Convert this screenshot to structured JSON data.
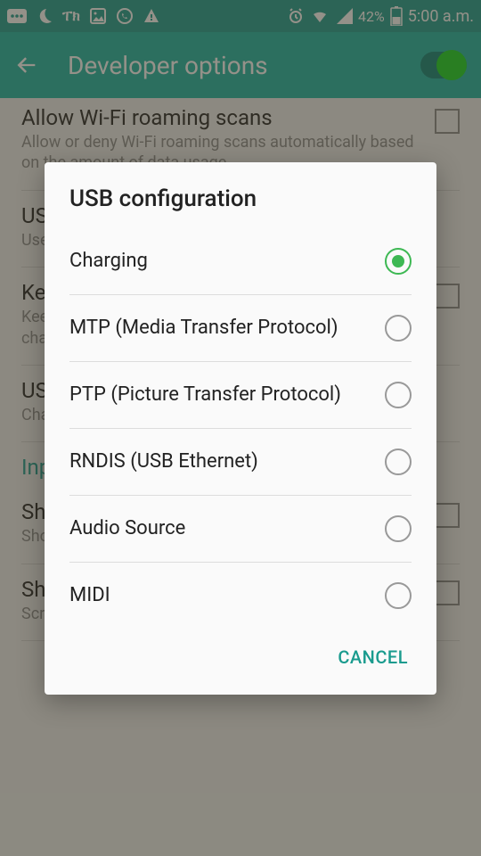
{
  "statusbar": {
    "battery_percent": "42%",
    "time": "5:00 a.m."
  },
  "header": {
    "title": "Developer options"
  },
  "settings": {
    "items": [
      {
        "title": "Allow Wi-Fi roaming scans",
        "sub": "Allow or deny Wi-Fi roaming scans automatically based on the amount of data usage.",
        "checkbox": true
      },
      {
        "title": "USB configuration",
        "sub": "Use legacy DHCP client instead of the new one.",
        "checkbox": false
      },
      {
        "title": "Keep awake",
        "sub": "Keep the screen on at all times when connected to a charger or USB. Screen switch will be disabled.",
        "checkbox": true
      },
      {
        "title": "USB configuration",
        "sub": "Charging",
        "checkbox": false
      },
      {
        "title": "Input",
        "sub": "",
        "checkbox": false,
        "link": true
      },
      {
        "title": "Show touches",
        "sub": "Show visual feedback for touches.",
        "checkbox": true
      },
      {
        "title": "Show pointer location",
        "sub": "Screen overlay showing current touch data.",
        "checkbox": true
      }
    ]
  },
  "dialog": {
    "title": "USB configuration",
    "options": [
      {
        "label": "Charging",
        "selected": true
      },
      {
        "label": "MTP (Media Transfer Protocol)",
        "selected": false
      },
      {
        "label": "PTP (Picture Transfer Protocol)",
        "selected": false
      },
      {
        "label": "RNDIS (USB Ethernet)",
        "selected": false
      },
      {
        "label": "Audio Source",
        "selected": false
      },
      {
        "label": "MIDI",
        "selected": false
      }
    ],
    "cancel_label": "CANCEL"
  }
}
